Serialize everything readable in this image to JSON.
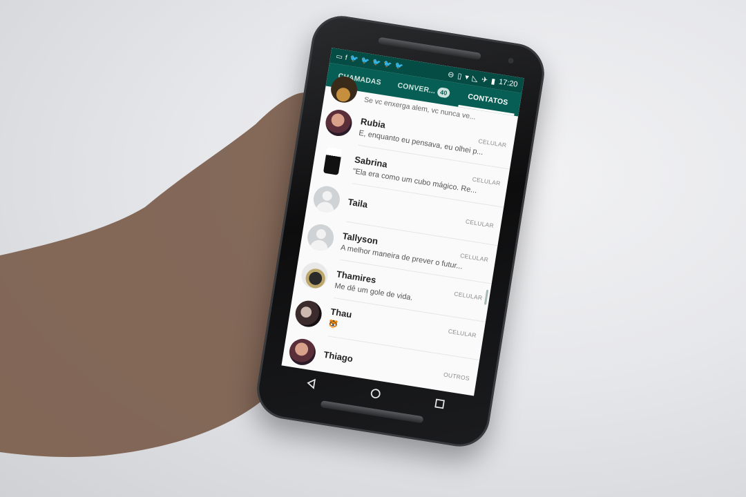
{
  "status_bar": {
    "time": "17:20",
    "left_icons": [
      "message-icon",
      "facebook-icon",
      "twitter-icon",
      "twitter-icon",
      "twitter-icon",
      "twitter-icon",
      "twitter-icon"
    ],
    "right_icons": [
      "do-not-disturb-icon",
      "vibrate-icon",
      "wifi-icon",
      "no-signal-icon",
      "airplane-icon",
      "battery-icon"
    ]
  },
  "tabs": [
    {
      "label": "CHAMADAS",
      "active": false
    },
    {
      "label": "CONVER...",
      "badge": "40",
      "active": false
    },
    {
      "label": "CONTATOS",
      "active": true
    }
  ],
  "top_partial_status": "Se vc enxerga alem, vc nunca ve...",
  "contacts": [
    {
      "name": "Rubia",
      "type": "CELULAR",
      "status": "E, enquanto eu pensava, eu olhei p...",
      "avatar": "photo1"
    },
    {
      "name": "Sabrina",
      "type": "CELULAR",
      "status": "\"Ela era como um cubo mágico. Re...",
      "avatar": "photo2"
    },
    {
      "name": "Taila",
      "type": "CELULAR",
      "status": "",
      "avatar": "default"
    },
    {
      "name": "Tallyson",
      "type": "CELULAR",
      "status": "A melhor maneira de prever o futur...",
      "avatar": "default"
    },
    {
      "name": "Thamires",
      "type": "CELULAR",
      "status": "Me dê um gole de vida.",
      "avatar": "photo3"
    },
    {
      "name": "Thau",
      "type": "CELULAR",
      "status": "🐯",
      "avatar": "photo4"
    },
    {
      "name": "Thiago",
      "type": "OUTROS",
      "status": "",
      "avatar": "photo1"
    }
  ],
  "nav": [
    "back-icon",
    "home-icon",
    "recents-icon"
  ],
  "colors": {
    "whatsapp_dark": "#054d44",
    "whatsapp_primary": "#075e54",
    "screen_bg": "#fafafa"
  }
}
